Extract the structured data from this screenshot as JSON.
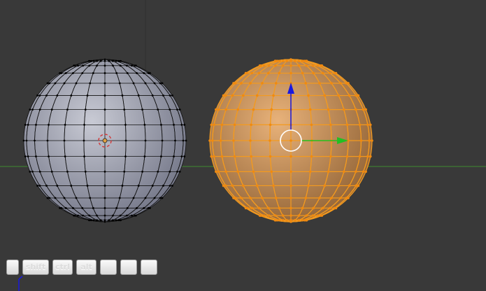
{
  "viewport": {
    "background": "#393939",
    "grid_line_color": "#2e2e2e",
    "x_axis_color": "#3f8a2e",
    "left_object": {
      "name": "sphere-unselected",
      "wire_color": "#101010",
      "fill_light": "#c8cad4",
      "fill_dark": "#6e7183"
    },
    "right_object": {
      "name": "sphere-selected",
      "wire_color": "#f39a1f",
      "fill_light": "#e8b27a",
      "fill_dark": "#8e6033"
    },
    "gizmo": {
      "x_color": "#22c022",
      "z_color": "#1818e0",
      "center_color": "#ffffff"
    },
    "cursor": {
      "ring_color": "#d23c3c",
      "dot_color": "#e0a040"
    }
  },
  "keybar": {
    "keys": [
      {
        "label": "",
        "kind": "k-first"
      },
      {
        "label": "shift",
        "kind": "k-shift"
      },
      {
        "label": "ctrl",
        "kind": "k-mod"
      },
      {
        "label": "alt",
        "kind": "k-mod"
      },
      {
        "label": "",
        "kind": "k-blank"
      },
      {
        "label": "",
        "kind": "k-blank"
      },
      {
        "label": "",
        "kind": "k-blank"
      }
    ]
  }
}
